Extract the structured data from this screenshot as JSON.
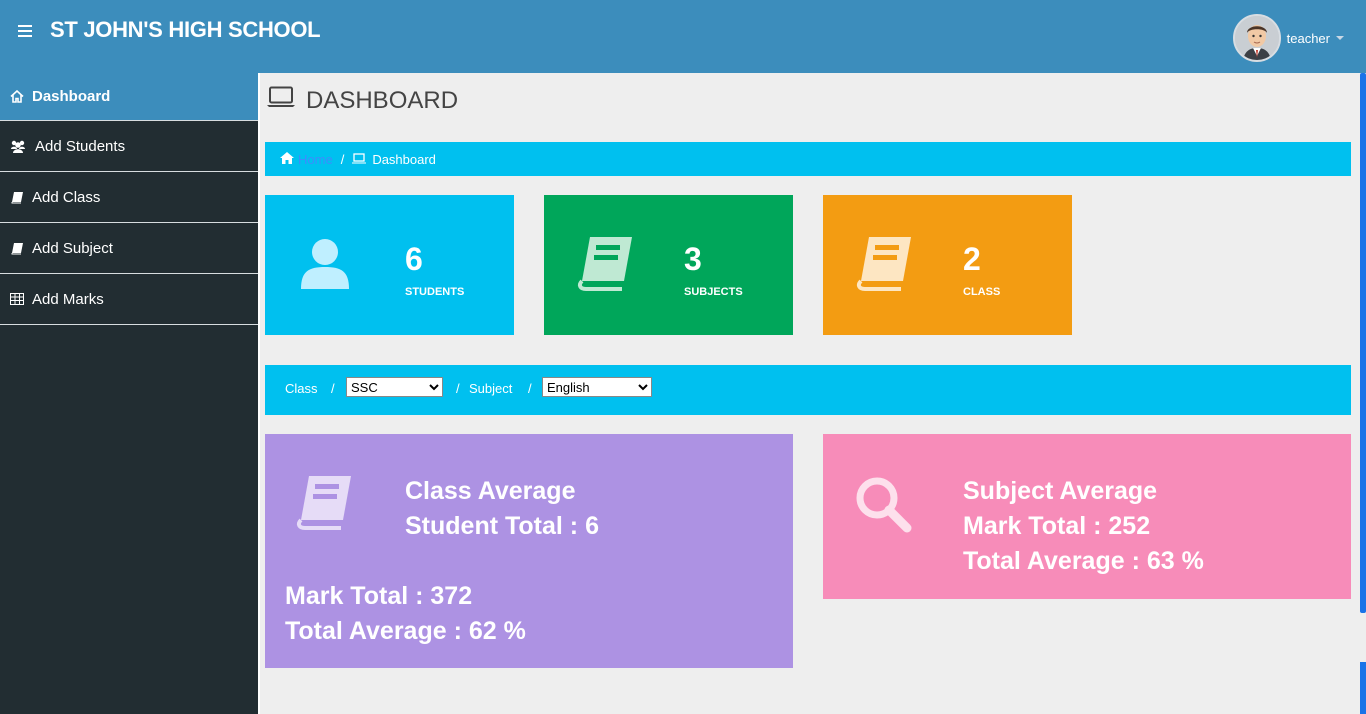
{
  "header": {
    "title": "ST JOHN'S HIGH SCHOOL",
    "user_name": "teacher"
  },
  "sidebar": {
    "items": [
      {
        "label": "Dashboard",
        "icon": "home-icon",
        "active": true
      },
      {
        "label": "Add Students",
        "icon": "users-icon"
      },
      {
        "label": "Add Class",
        "icon": "book-icon"
      },
      {
        "label": "Add Subject",
        "icon": "book-icon"
      },
      {
        "label": "Add Marks",
        "icon": "table-icon"
      }
    ]
  },
  "page": {
    "title": "DASHBOARD",
    "breadcrumb": {
      "home": "Home",
      "current": "Dashboard"
    }
  },
  "stats": [
    {
      "value": "6",
      "label": "STUDENTS",
      "color": "#00c0ef",
      "icon": "user-icon"
    },
    {
      "value": "3",
      "label": "SUBJECTS",
      "color": "#00a65a",
      "icon": "book-icon"
    },
    {
      "value": "2",
      "label": "CLASS",
      "color": "#f39c12",
      "icon": "book-icon"
    }
  ],
  "filter": {
    "class_label": "Class",
    "class_value": "SSC",
    "subject_label": "Subject",
    "subject_value": "English"
  },
  "class_card": {
    "title": "Class Average",
    "student_total": "Student Total : 6",
    "mark_total": "Mark Total : 372",
    "total_average": "Total Average : 62 %",
    "color": "#ad92e3"
  },
  "subject_card": {
    "title": "Subject Average",
    "mark_total": "Mark Total : 252",
    "total_average": "Total Average : 63 %",
    "color": "#f78cb9"
  }
}
